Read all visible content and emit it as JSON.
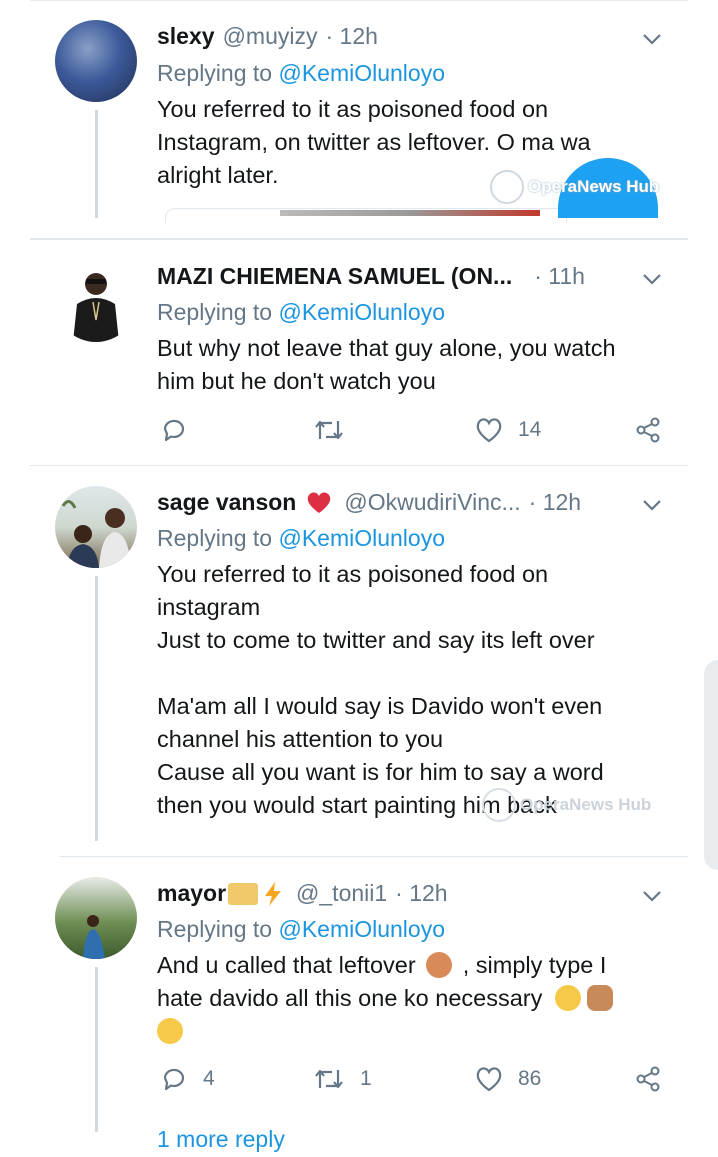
{
  "replying_prefix": "Replying to",
  "mention": "@KemiOlunloyo",
  "tweets": [
    {
      "name": "slexy",
      "handle": "@muyizy",
      "time": "· 12h",
      "body": [
        "You referred to it as poisoned food on",
        "Instagram, on twitter as leftover. O ma wa",
        "alright later."
      ]
    },
    {
      "name": "MAZI CHIEMENA SAMUEL (ON...",
      "time": "· 11h",
      "body": [
        "But why not leave that guy alone, you watch",
        "him but he don't watch you"
      ],
      "likes": "14"
    },
    {
      "name": "sage vanson",
      "handle": "@OkwudiriVinc...",
      "time": "· 12h",
      "body": [
        "You referred to it as poisoned food on",
        "instagram",
        "Just to come to twitter and say its left over",
        "",
        "Ma'am all I would say is Davido won't even",
        "channel his attention to you",
        "Cause all you want is for him to say a word",
        "then you would start painting him back"
      ]
    },
    {
      "name": "mayor",
      "handle": "@_tonii1",
      "time": "· 12h",
      "body_line1_a": "And u called that leftover",
      "body_line1_b": ", simply type I",
      "body_line2": "hate davido all this one ko necessary",
      "replies": "4",
      "retweets": "1",
      "likes": "86",
      "more_reply": "1 more reply"
    }
  ],
  "watermark": "OperaNews Hub",
  "colors": {
    "link": "#1b95e0",
    "muted": "#657786",
    "text": "#14171a",
    "heart": "#e0245e"
  }
}
